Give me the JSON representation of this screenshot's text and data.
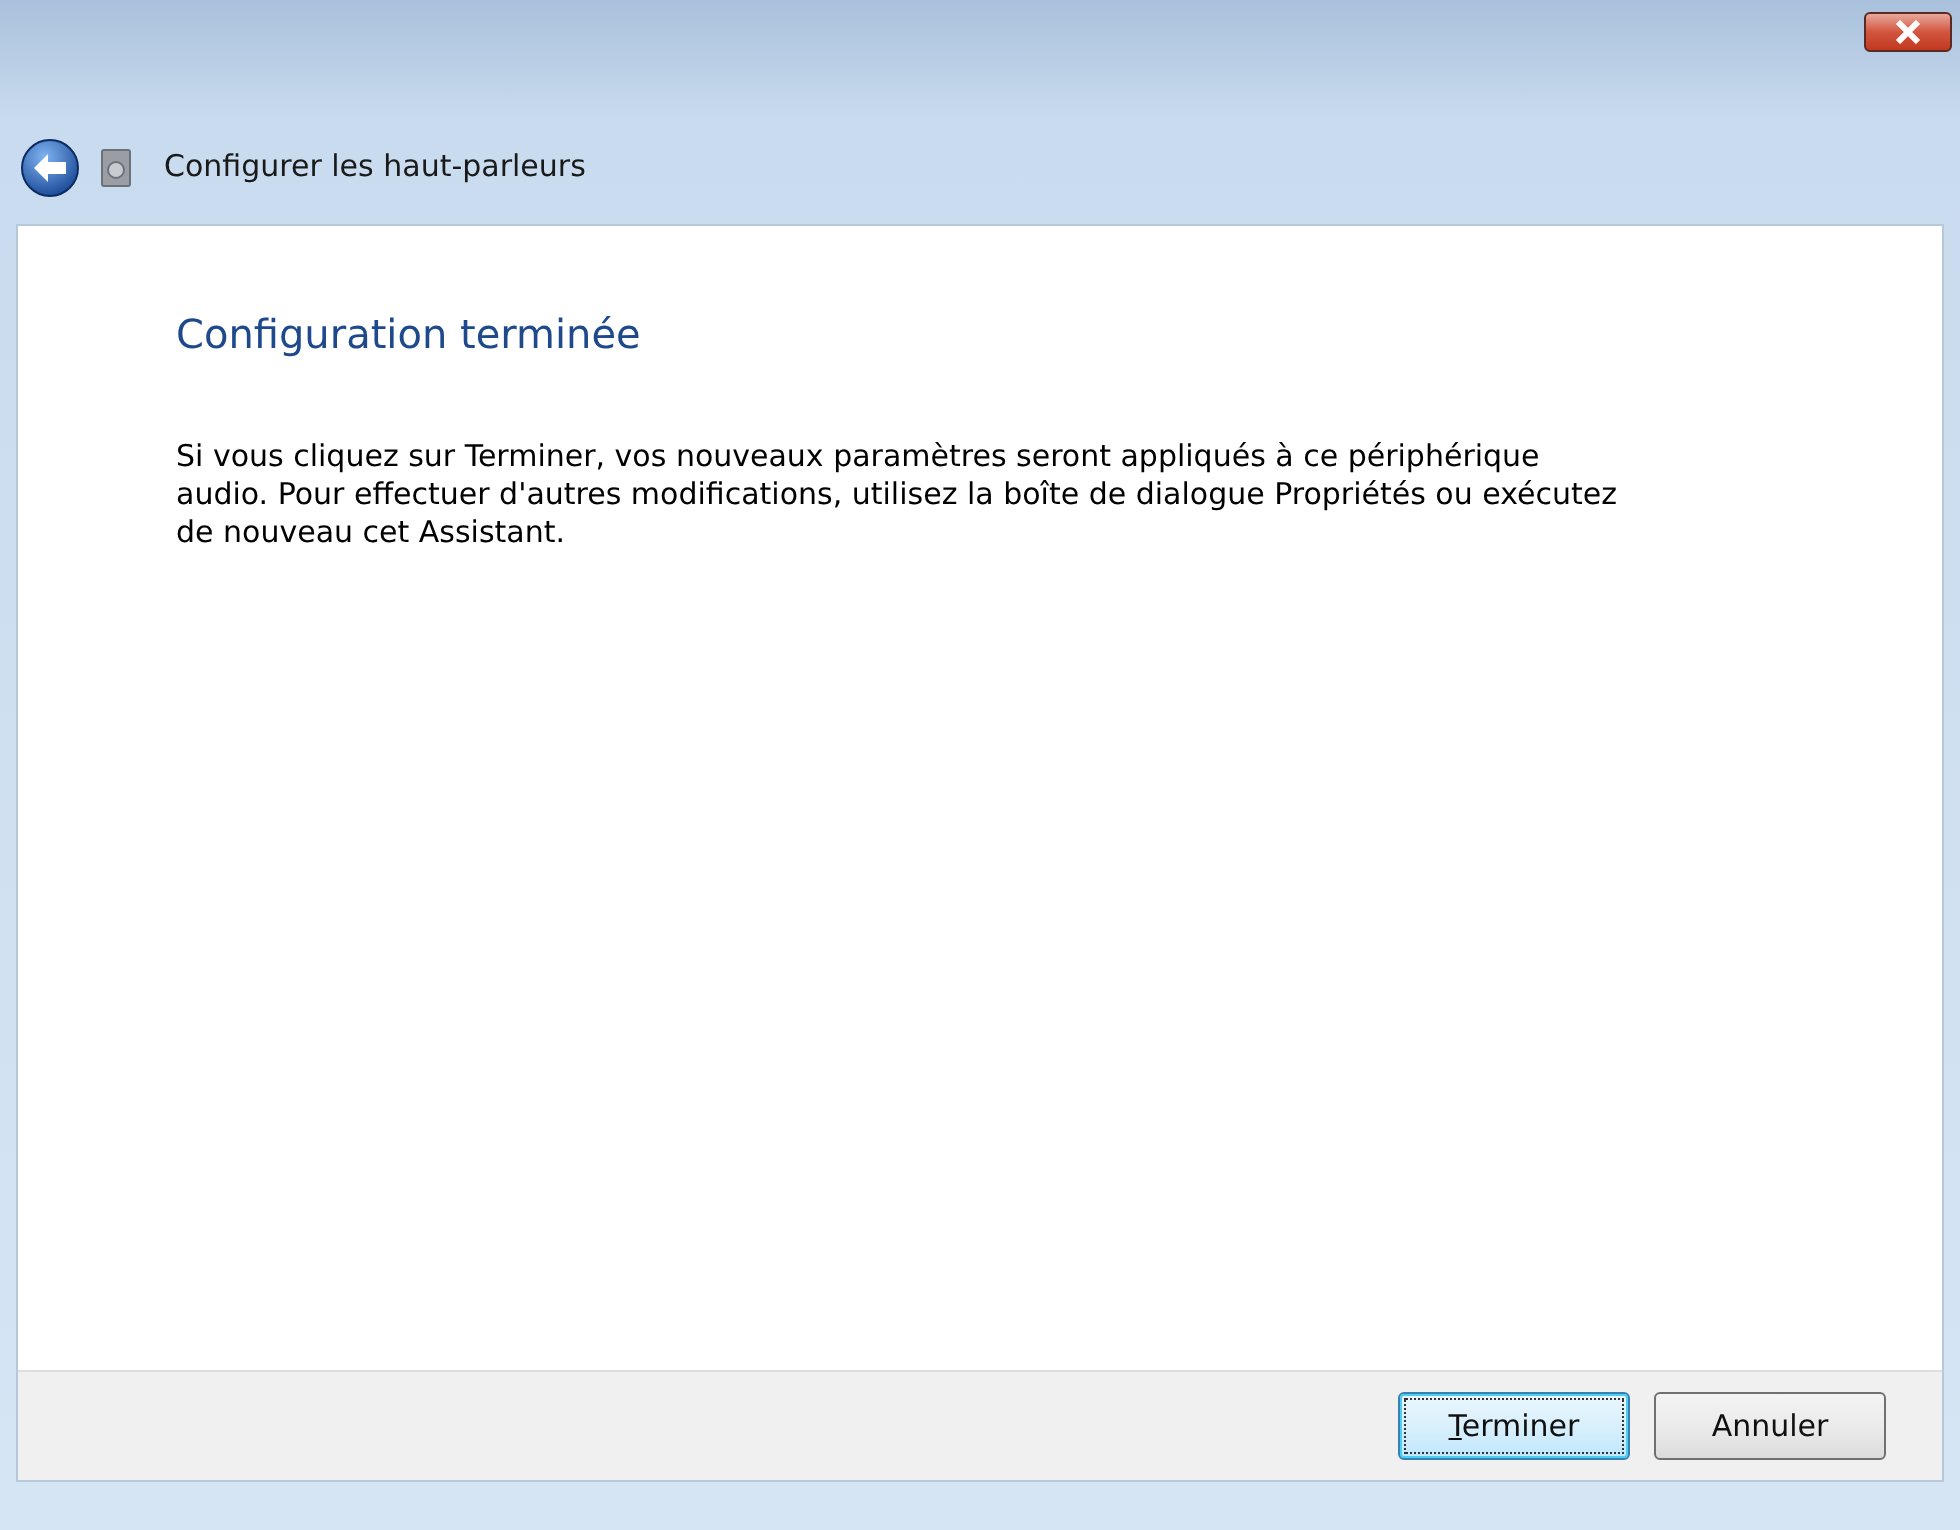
{
  "window": {
    "title": "Configurer les haut-parleurs"
  },
  "page": {
    "heading": "Configuration terminée",
    "body": "Si vous cliquez sur Terminer, vos nouveaux paramètres seront appliqués à ce périphérique audio. Pour effectuer d'autres modifications, utilisez la boîte de dialogue Propriétés ou exécutez de nouveau cet Assistant."
  },
  "buttons": [
    {
      "label": "Terminer",
      "first_letter_underlined": true,
      "default": true
    },
    {
      "label": "Annuler",
      "default": false
    }
  ]
}
